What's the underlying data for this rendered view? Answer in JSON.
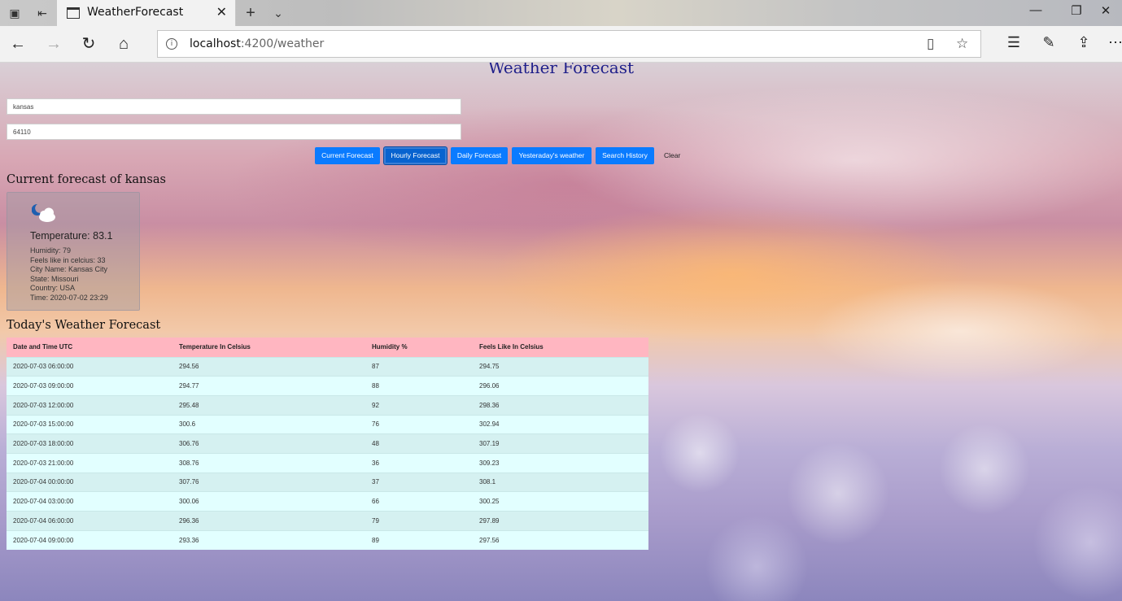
{
  "browser": {
    "tab_title": "WeatherForecast",
    "url_host": "localhost",
    "url_rest": ":4200/weather"
  },
  "app": {
    "title": "Weather Forecast",
    "city_input": "kansas",
    "zip_input": "64110",
    "buttons": {
      "current": "Current Forecast",
      "hourly": "Hourly Forecast",
      "daily": "Daily Forecast",
      "yesterday": "Yesteraday's weather",
      "history": "Search History",
      "clear": "Clear"
    }
  },
  "current": {
    "heading": "Current forecast of kansas",
    "icon": "partly-cloudy-night-icon",
    "temperature": "Temperature: 83.1",
    "humidity": "Humidity: 79",
    "feels_like": "Feels like in celcius: 33",
    "city": "City Name: Kansas City",
    "state": "State: Missouri",
    "country": "Country: USA",
    "time": "Time: 2020-07-02 23:29"
  },
  "today": {
    "heading": "Today's Weather Forecast",
    "columns": [
      "Date and Time UTC",
      "Temperature In Celsius",
      "Humidity %",
      "Feels Like In Celsius"
    ],
    "rows": [
      [
        "2020-07-03 06:00:00",
        "294.56",
        "87",
        "294.75"
      ],
      [
        "2020-07-03 09:00:00",
        "294.77",
        "88",
        "296.06"
      ],
      [
        "2020-07-03 12:00:00",
        "295.48",
        "92",
        "298.36"
      ],
      [
        "2020-07-03 15:00:00",
        "300.6",
        "76",
        "302.94"
      ],
      [
        "2020-07-03 18:00:00",
        "306.76",
        "48",
        "307.19"
      ],
      [
        "2020-07-03 21:00:00",
        "308.76",
        "36",
        "309.23"
      ],
      [
        "2020-07-04 00:00:00",
        "307.76",
        "37",
        "308.1"
      ],
      [
        "2020-07-04 03:00:00",
        "300.06",
        "66",
        "300.25"
      ],
      [
        "2020-07-04 06:00:00",
        "296.36",
        "79",
        "297.89"
      ],
      [
        "2020-07-04 09:00:00",
        "293.36",
        "89",
        "297.56"
      ]
    ]
  },
  "colors": {
    "button": "#0a7bff",
    "table_header": "#ffb6c1",
    "row_odd": "#d5f1f1",
    "row_even": "#e2ffff",
    "title": "#1f1f8a"
  }
}
